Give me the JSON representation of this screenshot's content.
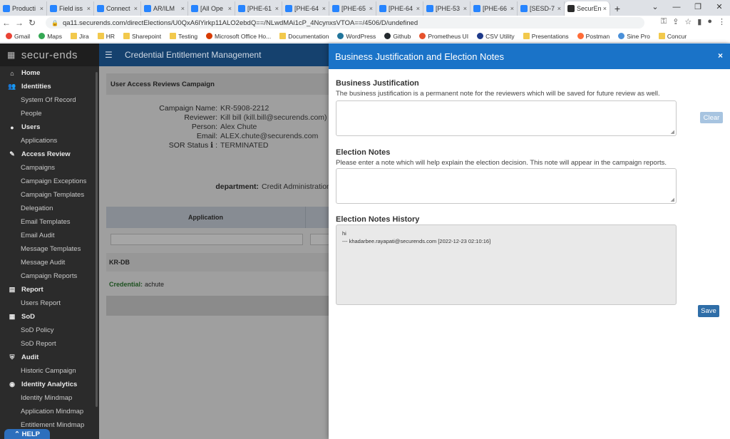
{
  "browser": {
    "tabs": [
      {
        "label": "Producti"
      },
      {
        "label": "Field iss"
      },
      {
        "label": "Connect"
      },
      {
        "label": "AR/ILM"
      },
      {
        "label": "[All Ope"
      },
      {
        "label": "[PHE-61"
      },
      {
        "label": "[PHE-64"
      },
      {
        "label": "[PHE-65"
      },
      {
        "label": "[PHE-64"
      },
      {
        "label": "[PHE-53"
      },
      {
        "label": "[PHE-66"
      },
      {
        "label": "[SESD-7"
      },
      {
        "label": "SecurEn"
      }
    ],
    "url": "qa11.securends.com/directElections/U0QxA6lYirkp11ALO2ebdQ==/NLwdMAi1cP_4NcynxsVTOA==/4506/D/undefined",
    "bookmarks": [
      {
        "label": "Gmail",
        "icon": "gmail-icon"
      },
      {
        "label": "Maps",
        "icon": "maps-icon"
      },
      {
        "label": "Jira",
        "icon": "folder-icon"
      },
      {
        "label": "HR",
        "icon": "folder-icon"
      },
      {
        "label": "Sharepoint",
        "icon": "folder-icon"
      },
      {
        "label": "Testing",
        "icon": "folder-icon"
      },
      {
        "label": "Microsoft Office Ho...",
        "icon": "office-icon"
      },
      {
        "label": "Documentation",
        "icon": "folder-icon"
      },
      {
        "label": "WordPress",
        "icon": "wordpress-icon"
      },
      {
        "label": "Github",
        "icon": "github-icon"
      },
      {
        "label": "Prometheus UI",
        "icon": "prometheus-icon"
      },
      {
        "label": "CSV Utility",
        "icon": "csv-icon"
      },
      {
        "label": "Presentations",
        "icon": "folder-icon"
      },
      {
        "label": "Postman",
        "icon": "postman-icon"
      },
      {
        "label": "Sine Pro",
        "icon": "sinepro-icon"
      },
      {
        "label": "Concur",
        "icon": "folder-icon"
      }
    ]
  },
  "app": {
    "logo": "secur-ends",
    "header_title": "Credential Entitlement Management",
    "help_label": "HELP",
    "nav": [
      {
        "label": "Home",
        "type": "section",
        "icon": "home-icon"
      },
      {
        "label": "Identities",
        "type": "section",
        "icon": "users-icon"
      },
      {
        "label": "System Of Record",
        "type": "sub"
      },
      {
        "label": "People",
        "type": "sub"
      },
      {
        "label": "Users",
        "type": "section",
        "icon": "user-icon"
      },
      {
        "label": "Applications",
        "type": "sub"
      },
      {
        "label": "Access Review",
        "type": "section",
        "icon": "wrench-icon"
      },
      {
        "label": "Campaigns",
        "type": "sub"
      },
      {
        "label": "Campaign Exceptions",
        "type": "sub"
      },
      {
        "label": "Campaign Templates",
        "type": "sub"
      },
      {
        "label": "Delegation",
        "type": "sub"
      },
      {
        "label": "Email Templates",
        "type": "sub"
      },
      {
        "label": "Email Audit",
        "type": "sub"
      },
      {
        "label": "Message Templates",
        "type": "sub"
      },
      {
        "label": "Message Audit",
        "type": "sub"
      },
      {
        "label": "Campaign Reports",
        "type": "sub"
      },
      {
        "label": "Report",
        "type": "section",
        "icon": "report-icon"
      },
      {
        "label": "Users Report",
        "type": "sub"
      },
      {
        "label": "SoD",
        "type": "section",
        "icon": "sod-icon"
      },
      {
        "label": "SoD Policy",
        "type": "sub"
      },
      {
        "label": "SoD Report",
        "type": "sub"
      },
      {
        "label": "Audit",
        "type": "section",
        "icon": "shield-icon"
      },
      {
        "label": "Historic Campaign",
        "type": "sub"
      },
      {
        "label": "Identity Analytics",
        "type": "section",
        "icon": "analytics-icon"
      },
      {
        "label": "Identity Mindmap",
        "type": "sub"
      },
      {
        "label": "Application Mindmap",
        "type": "sub"
      },
      {
        "label": "Entitlement Mindmap",
        "type": "sub"
      }
    ],
    "campaign": {
      "heading": "User Access Reviews Campaign",
      "fields": [
        {
          "label": "Campaign Name:",
          "value": "KR-5908-2212"
        },
        {
          "label": "Reviewer:",
          "value": "Kill bill (kill.bill@securends.com)"
        },
        {
          "label": "Person:",
          "value": "Alex Chute"
        },
        {
          "label": "Email:",
          "value": "ALEX.chute@securends.com"
        },
        {
          "label": "SOR Status",
          "value": "TERMINATED"
        }
      ],
      "department_label": "department:",
      "department_value": "Credit Administration",
      "table_header_application": "Application",
      "app_row": "KR-DB",
      "credential_label": "Credential:",
      "credential_value": "achute"
    }
  },
  "modal": {
    "title": "Business Justification and Election Notes",
    "close": "×",
    "business_justification": {
      "title": "Business Justification",
      "description": "The business justification is a permanent note for the reviewers which will be saved for future review as well.",
      "value": ""
    },
    "clear_label": "Clear",
    "election_notes": {
      "title": "Election Notes",
      "description": "Please enter a note which will help explain the election decision. This note will appear in the campaign reports.",
      "value": ""
    },
    "history": {
      "title": "Election Notes History",
      "lines": [
        "hi",
        "--- khadarbee.rayapati@securends.com [2022-12-23 02:10:16]"
      ]
    },
    "save_label": "Save"
  }
}
